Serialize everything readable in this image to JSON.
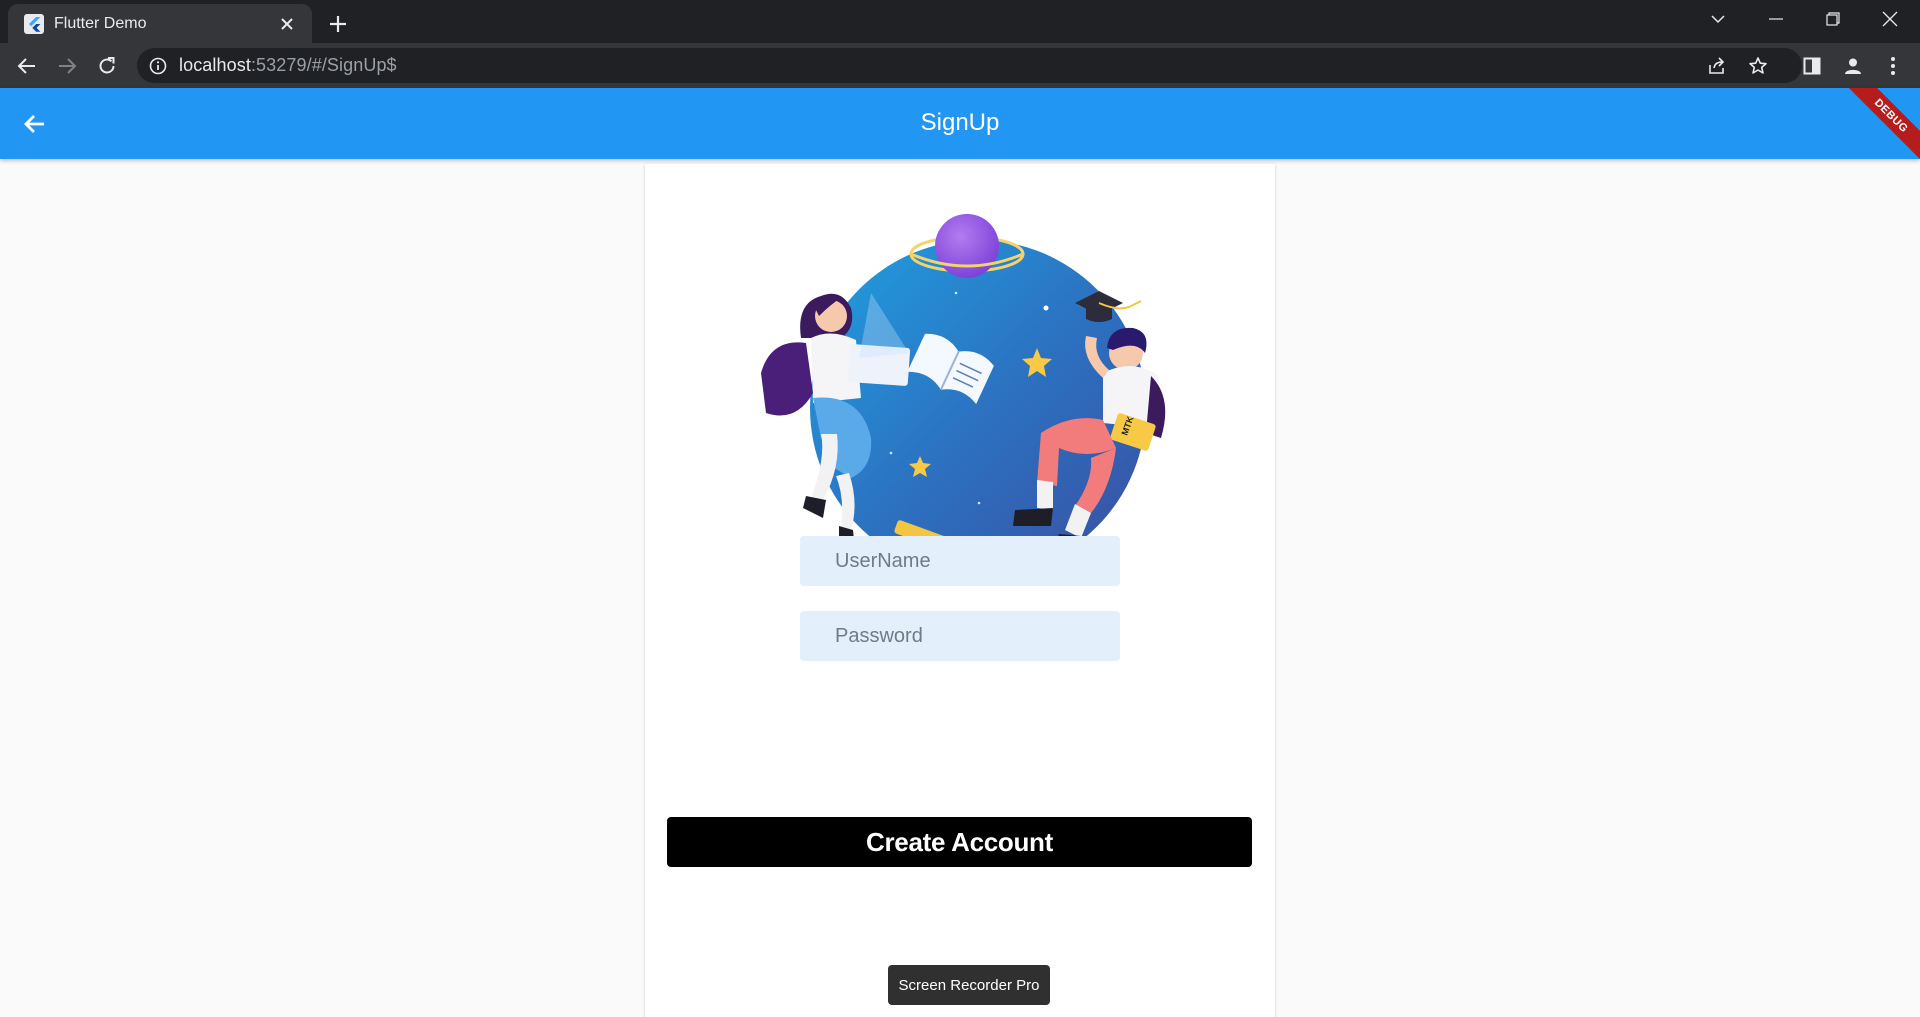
{
  "browser": {
    "tab_title": "Flutter Demo",
    "url_host": "localhost",
    "url_rest": ":53279/#/SignUp$"
  },
  "appbar": {
    "title": "SignUp",
    "debug_banner": "DEBUG",
    "color": "#2196f3"
  },
  "illustration": {
    "book_label": "MTK"
  },
  "form": {
    "username_placeholder": "UserName",
    "password_placeholder": "Password",
    "create_button_label": "Create Account"
  },
  "tooltip": {
    "text": "Screen Recorder Pro"
  },
  "icons": [
    "flutter-icon",
    "close-icon",
    "plus-icon",
    "chevron-down-icon",
    "minimize-icon",
    "restore-icon",
    "window-close-icon",
    "back-arrow-icon",
    "forward-arrow-icon",
    "reload-icon",
    "info-icon",
    "share-icon",
    "star-icon",
    "side-panel-icon",
    "profile-icon",
    "kebab-menu-icon"
  ]
}
